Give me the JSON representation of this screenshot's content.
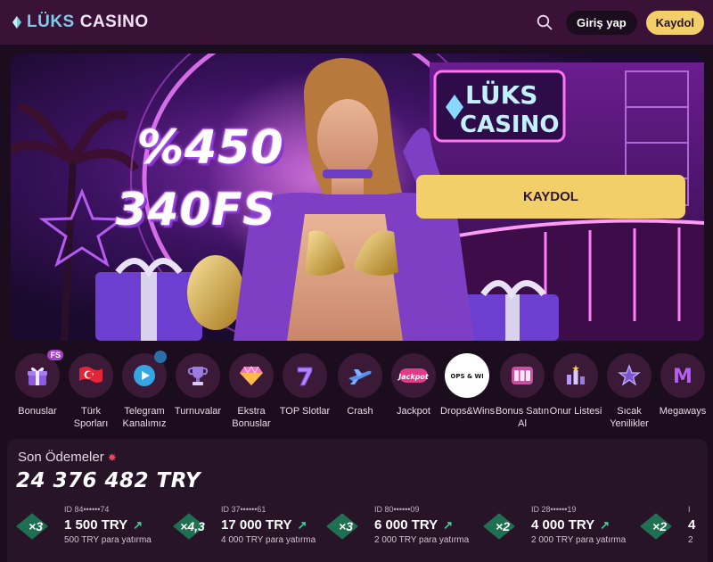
{
  "header": {
    "logo_luks": "LÜKS",
    "logo_casino": "CASINO",
    "login_label": "Giriş yap",
    "register_label": "Kaydol"
  },
  "hero": {
    "promo_line1": "%450",
    "promo_line2": "340FS",
    "sign_line1": "LÜKS",
    "sign_line2": "CASINO",
    "cta_label": "KAYDOL"
  },
  "categories": [
    {
      "label": "Bonuslar",
      "icon": "gift-icon",
      "badge": "FS"
    },
    {
      "label": "Türk Sporları",
      "icon": "turkish-flag-icon"
    },
    {
      "label": "Telegram Kanalımız",
      "icon": "telegram-icon",
      "badge_icon": "arrow-icon"
    },
    {
      "label": "Turnuvalar",
      "icon": "trophy-icon"
    },
    {
      "label": "Ekstra Bonuslar",
      "icon": "diamond-icon"
    },
    {
      "label": "TOP Slotlar",
      "icon": "lucky-seven-icon"
    },
    {
      "label": "Crash",
      "icon": "jet-icon"
    },
    {
      "label": "Jackpot",
      "icon": "jackpot-icon",
      "icon_text": "Jackpot"
    },
    {
      "label": "Drops&Wins",
      "icon": "drops-wins-icon",
      "icon_text": "DROPS & WINS"
    },
    {
      "label": "Bonus Satın Al",
      "icon": "slot-machine-icon"
    },
    {
      "label": "Onur Listesi",
      "icon": "leaderboard-icon"
    },
    {
      "label": "Sıcak Yenilikler",
      "icon": "star-icon"
    },
    {
      "label": "Megaways",
      "icon": "megaways-icon",
      "icon_text": "M"
    }
  ],
  "payouts": {
    "title": "Son Ödemeler",
    "total": "24 376 482 TRY",
    "items": [
      {
        "mult": "×3",
        "id": "ID 84••••••74",
        "amount": "1 500 TRY",
        "deposit": "500 TRY para yatırma"
      },
      {
        "mult": "×4,3",
        "id": "ID 37••••••61",
        "amount": "17 000 TRY",
        "deposit": "4 000 TRY para yatırma"
      },
      {
        "mult": "×3",
        "id": "ID 80••••••09",
        "amount": "6 000 TRY",
        "deposit": "2 000 TRY para yatırma"
      },
      {
        "mult": "×2",
        "id": "ID 28••••••19",
        "amount": "4 000 TRY",
        "deposit": "2 000 TRY para yatırma"
      },
      {
        "mult": "×2",
        "id": "I",
        "amount": "4",
        "deposit": "2"
      }
    ]
  },
  "colors": {
    "header_bg": "#3a1238",
    "page_bg": "#1c0d1e",
    "accent_yellow": "#f2cf68",
    "multiplier_green": "#1f6f52",
    "arrow_green": "#3fcf8e"
  }
}
